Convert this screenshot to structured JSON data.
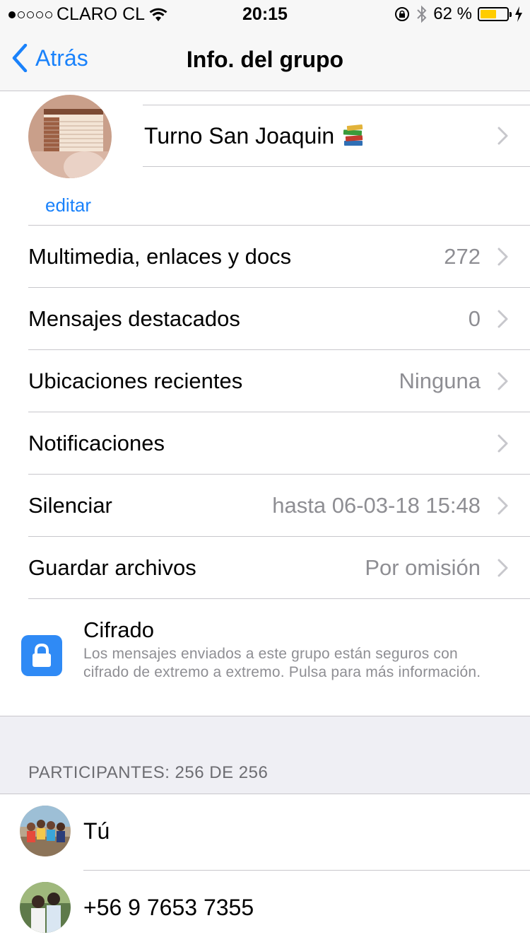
{
  "status_bar": {
    "carrier": "CLARO CL",
    "time": "20:15",
    "battery_percent": "62 %",
    "battery_level": 0.62,
    "battery_color": "#ffcc00"
  },
  "nav": {
    "back_label": "Atrás",
    "title": "Info. del grupo"
  },
  "group": {
    "name": "Turno San Joaquin",
    "edit_label": "editar"
  },
  "rows": [
    {
      "label": "Multimedia, enlaces y docs",
      "value": "272"
    },
    {
      "label": "Mensajes destacados",
      "value": "0"
    },
    {
      "label": "Ubicaciones recientes",
      "value": "Ninguna"
    },
    {
      "label": "Notificaciones",
      "value": ""
    },
    {
      "label": "Silenciar",
      "value": "hasta 06-03-18 15:48"
    },
    {
      "label": "Guardar archivos",
      "value": "Por omisión"
    }
  ],
  "encryption": {
    "title": "Cifrado",
    "description": "Los mensajes enviados a este grupo están seguros con cifrado de extremo a extremo. Pulsa para más información."
  },
  "participants": {
    "section_title": "PARTICIPANTES: 256 DE 256",
    "items": [
      {
        "name": "Tú"
      },
      {
        "name": "+56 9 7653 7355"
      }
    ]
  },
  "colors": {
    "accent": "#1a82fb",
    "secondary_text": "#8e8e93",
    "lock_tile": "#2f8af5",
    "section_bg": "#efeff4"
  }
}
